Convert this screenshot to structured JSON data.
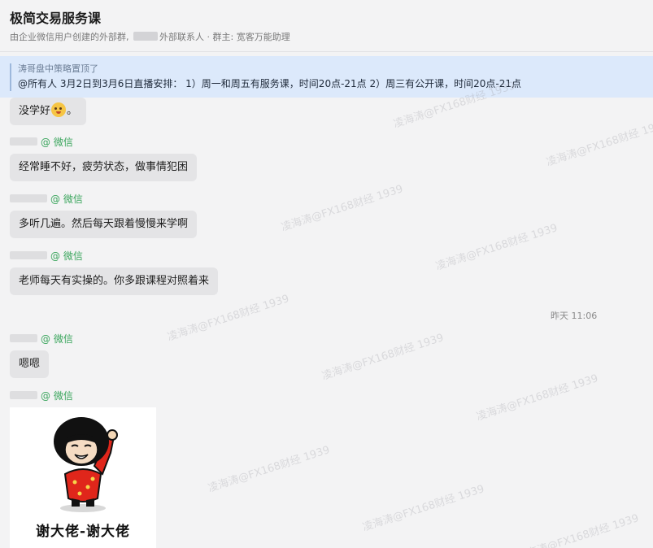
{
  "header": {
    "title": "极简交易服务课",
    "subtitle_prefix": "由企业微信用户创建的外部群, ",
    "subtitle_suffix": "外部联系人 · 群主: 宽客万能助理"
  },
  "pinned": {
    "by": "涛哥盘中策略置顶了",
    "text": "@所有人 3月2日到3月6日直播安排： 1）周一和周五有服务课，时间20点-21点 2）周三有公开课，时间20点-21点"
  },
  "messages": [
    {
      "text": "没学好",
      "suffix": "。",
      "has_emoji": true
    },
    {
      "text": "经常睡不好，疲劳状态，做事情犯困"
    },
    {
      "text": "多听几遍。然后每天跟着慢慢来学啊"
    },
    {
      "text": "老师每天有实操的。你多跟课程对照着来"
    },
    {
      "text": "嗯嗯"
    }
  ],
  "senders": [
    {
      "source": "@ 微信"
    },
    {
      "source": "@ 微信"
    },
    {
      "source": "@ 微信"
    },
    {
      "source": "@ 微信"
    },
    {
      "source": "@ 微信"
    }
  ],
  "timestamp": "昨天 11:06",
  "sticker": {
    "caption": "谢大佬-谢大佬"
  },
  "watermark": "凌海涛@FX168财经 1939",
  "colors": {
    "pinned_bg": "#dce9fb",
    "bubble_bg": "#e4e4e6",
    "wechat_green": "#3aa55c"
  }
}
